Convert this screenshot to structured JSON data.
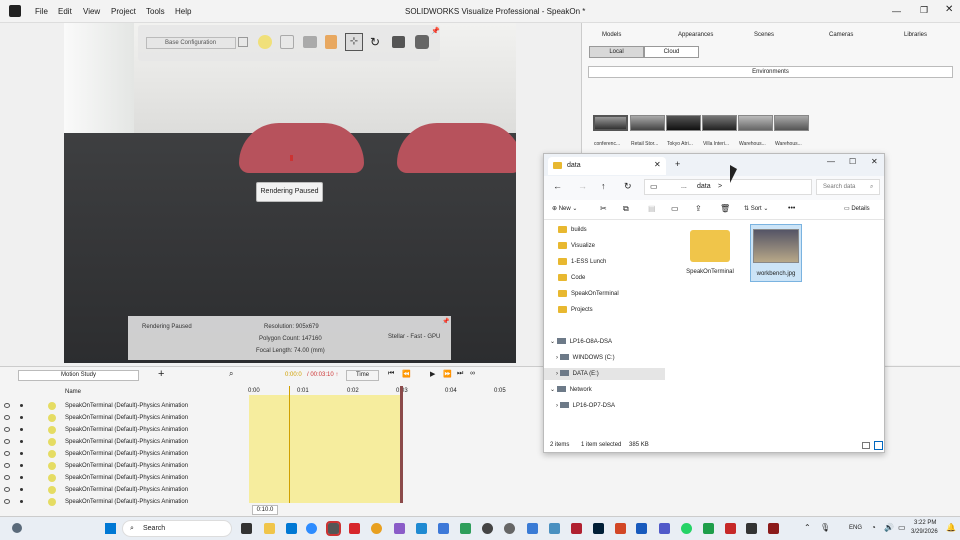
{
  "app": {
    "title": "SOLIDWORKS Visualize Professional - SpeakOn *",
    "menu": [
      "File",
      "Edit",
      "View",
      "Project",
      "Tools",
      "Help"
    ]
  },
  "viewport": {
    "config": "Base Configuration",
    "paused_label": "Rendering Paused",
    "info": {
      "status": "Rendering Paused",
      "resolution": "Resolution: 905x679",
      "polygons": "Polygon Count: 147160",
      "focal": "Focal Length: 74.00 (mm)",
      "engine": "Stellar - Fast - GPU"
    }
  },
  "right_panel": {
    "tabs": [
      "Models",
      "Appearances",
      "Scenes",
      "Cameras",
      "Libraries"
    ],
    "local": "Local",
    "cloud": "Cloud",
    "dropdown": "Environments",
    "thumbs": [
      "conferenc...",
      "Retail Stor...",
      "Tokyo Atri...",
      "Villa Interi...",
      "Warehous...",
      "Warehous..."
    ]
  },
  "explorer": {
    "tab_title": "data",
    "new_tab": "+",
    "path": [
      "...",
      "data",
      ">"
    ],
    "search_placeholder": "Search data",
    "commands": {
      "new": "New",
      "sort": "Sort",
      "more": "•••",
      "details": "Details"
    },
    "nav": [
      {
        "label": "builds",
        "type": "folder",
        "pinned": true
      },
      {
        "label": "Visualize",
        "type": "folder",
        "pinned": true
      },
      {
        "label": "1-ESS Lunch",
        "type": "folder",
        "pinned": true
      },
      {
        "label": "Code",
        "type": "folder",
        "pinned": true
      },
      {
        "label": "SpeakOnTerminal",
        "type": "folder",
        "pinned": true
      },
      {
        "label": "Projects",
        "type": "folder",
        "pinned": true
      },
      {
        "label": "LP16-O8A-DSA",
        "type": "pc",
        "expanded": true
      },
      {
        "label": "WINDOWS (C:)",
        "type": "drive"
      },
      {
        "label": "DATA (E:)",
        "type": "drive",
        "selected": true
      },
      {
        "label": "Network",
        "type": "network",
        "expanded": true
      },
      {
        "label": "LP16-OP7-DSA",
        "type": "pc"
      }
    ],
    "files": [
      {
        "name": "SpeakOnTerminal",
        "type": "folder"
      },
      {
        "name": "workbench.jpg",
        "type": "image",
        "selected": true
      }
    ],
    "status": {
      "items": "2 items",
      "selected": "1 item selected",
      "size": "385 KB"
    }
  },
  "timeline": {
    "study": "Motion Study",
    "time_dropdown": "Time",
    "time_current": "0:00:0",
    "time_total": "/ 00:03:10 ↑",
    "column_name": "Name",
    "ticks": [
      "0:00",
      "0:01",
      "0:02",
      "0:03",
      "0:04",
      "0:05"
    ],
    "rows": [
      "SpeakOnTerminal (Default)-Physics Animation",
      "SpeakOnTerminal (Default)-Physics Animation",
      "SpeakOnTerminal (Default)-Physics Animation",
      "SpeakOnTerminal (Default)-Physics Animation",
      "SpeakOnTerminal (Default)-Physics Animation",
      "SpeakOnTerminal (Default)-Physics Animation",
      "SpeakOnTerminal (Default)-Physics Animation",
      "SpeakOnTerminal (Default)-Physics Animation",
      "SpeakOnTerminal (Default)-Physics Animation"
    ],
    "zoom": "0:10.0"
  },
  "taskbar": {
    "search": "Search",
    "lang": "ENG",
    "time": "3:22 PM",
    "date": "3/29/2026"
  },
  "colors": {
    "accent": "#0067c0",
    "track": "#f6ed9e",
    "chair": "#b7525c"
  }
}
